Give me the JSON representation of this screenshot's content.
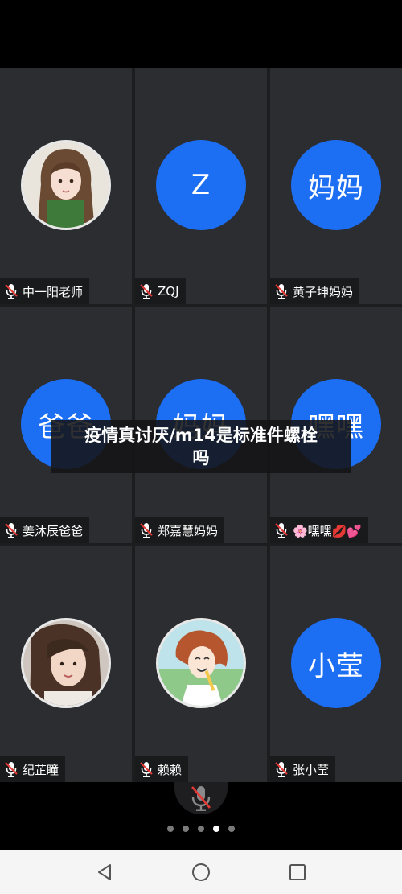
{
  "participants": [
    {
      "name": "中一阳老师",
      "avatar_text": "",
      "avatar_type": "photo-anime-girl"
    },
    {
      "name": "ZQJ",
      "avatar_text": "Z",
      "avatar_type": "text"
    },
    {
      "name": "黄子坤妈妈",
      "avatar_text": "妈妈",
      "avatar_type": "text"
    },
    {
      "name": "姜沐辰爸爸",
      "avatar_text": "爸爸",
      "avatar_type": "text"
    },
    {
      "name": "郑嘉慧妈妈",
      "avatar_text": "妈妈",
      "avatar_type": "text"
    },
    {
      "name": "🌸嘿嘿💋💕",
      "avatar_text": "嘿嘿",
      "avatar_type": "text"
    },
    {
      "name": "纪芷瞳",
      "avatar_text": "",
      "avatar_type": "photo-woman"
    },
    {
      "name": "赖赖",
      "avatar_text": "",
      "avatar_type": "photo-cartoon"
    },
    {
      "name": "张小莹",
      "avatar_text": "小莹",
      "avatar_type": "text"
    }
  ],
  "banner": {
    "line1": "疫情真讨厌/m14是标准件螺栓",
    "line2": "吗"
  },
  "pagination": {
    "total": 5,
    "active": 4
  },
  "icons": {
    "tile_mic": "mic-muted-icon",
    "mute_button": "mic-off-icon",
    "nav": [
      "back-icon",
      "home-icon",
      "recents-icon"
    ]
  },
  "colors": {
    "avatar_blue": "#1c6ef3",
    "tile_bg": "#2c2d30",
    "mute_red": "#e53935"
  }
}
